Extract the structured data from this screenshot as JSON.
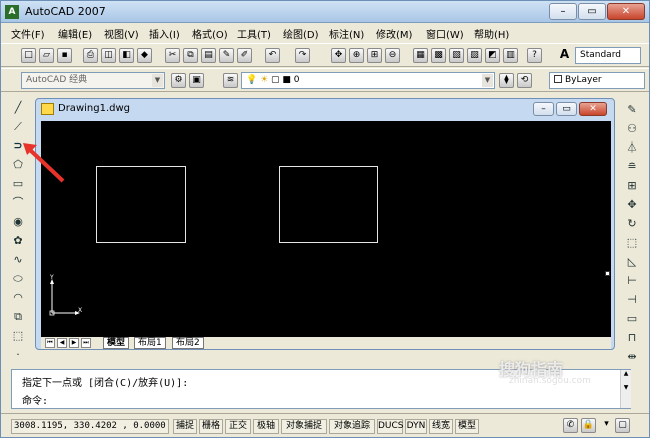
{
  "window": {
    "title": "AutoCAD 2007",
    "icon": "A"
  },
  "menu": [
    "文件(F)",
    "编辑(E)",
    "视图(V)",
    "插入(I)",
    "格式(O)",
    "工具(T)",
    "绘图(D)",
    "标注(N)",
    "修改(M)",
    "窗口(W)",
    "帮助(H)"
  ],
  "toolbar": {
    "text_style": "Standard",
    "workspace": "AutoCAD 经典",
    "layer": "0",
    "color": "ByLayer"
  },
  "drawing": {
    "title": "Drawing1.dwg",
    "ucs_x": "X",
    "ucs_y": "Y",
    "layout_tabs": [
      "模型",
      "布局1",
      "布局2"
    ]
  },
  "command": {
    "line1": "指定下一点或 [闭合(C)/放弃(U)]:",
    "line2": "命令:"
  },
  "status": {
    "coords": "3008.1195, 330.4202 , 0.0000",
    "buttons": [
      "捕捉",
      "栅格",
      "正交",
      "极轴",
      "对象捕捉",
      "对象追踪",
      "DUCS",
      "DYN",
      "线宽",
      "模型"
    ]
  },
  "watermark": {
    "main": "搜狗指南",
    "sub": "zhinan.sogou.com"
  },
  "colors": {
    "canvas": "#000000",
    "annotation_arrow": "#e8332b",
    "title_bar": "#a9c6e6"
  },
  "icons": {
    "left_draw": [
      "line-icon",
      "construction-line-icon",
      "polyline-icon",
      "polygon-icon",
      "rectangle-icon",
      "arc-icon",
      "circle-icon",
      "revision-cloud-icon",
      "spline-icon",
      "ellipse-icon",
      "ellipse-arc-icon",
      "insert-block-icon",
      "make-block-icon",
      "point-icon"
    ],
    "right_modify": [
      "erase-icon",
      "copy-icon",
      "mirror-icon",
      "offset-icon",
      "array-icon",
      "move-icon",
      "rotate-icon",
      "scale-icon",
      "stretch-icon",
      "trim-icon",
      "extend-icon",
      "break-icon",
      "chamfer-icon",
      "fillet-icon",
      "explode-icon"
    ]
  }
}
